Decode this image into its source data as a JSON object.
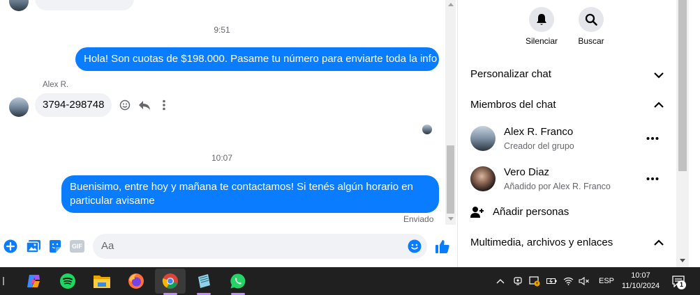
{
  "chat": {
    "time_1": "9:51",
    "msg_out_1": "Hola! Son cuotas de $198.000. Pasame tu número para enviarte toda la info",
    "sender_name": "Alex R.",
    "msg_in_1": "3794-298748",
    "time_2": "10:07",
    "msg_out_2_line1": "Buenisimo, entre hoy y mañana te contactamos! Si tenés algún horario en",
    "msg_out_2_line2": "particular avisame",
    "status": "Enviado",
    "composer_placeholder": "Aa",
    "gif_label": "GIF"
  },
  "sidebar": {
    "mute_label": "Silenciar",
    "search_label": "Buscar",
    "customize_label": "Personalizar chat",
    "members_label": "Miembros del chat",
    "members": [
      {
        "name": "Alex R. Franco",
        "role": "Creador del grupo"
      },
      {
        "name": "Vero Diaz",
        "role": "Añadido por Alex R. Franco"
      }
    ],
    "add_people_label": "Añadir personas",
    "media_label": "Multimedia, archivos y enlaces"
  },
  "taskbar": {
    "lang": "ESP",
    "time": "10:07",
    "date": "11/10/2024",
    "notif_count": "1"
  },
  "colors": {
    "accent": "#0a7cff",
    "bubble_in": "#f0f2f5",
    "taskbar": "#202020"
  }
}
